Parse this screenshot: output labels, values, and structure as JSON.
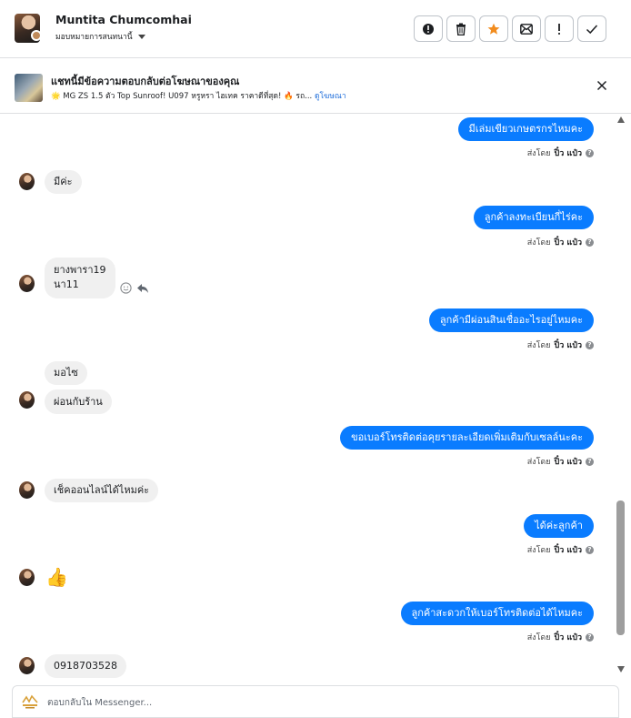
{
  "header": {
    "contact_name": "Muntita Chumcomhai",
    "assign_label": "มอบหมายการสนทนานี้",
    "actions": [
      {
        "icon": "exclamation-circle-icon",
        "glyph": "!"
      },
      {
        "icon": "trash-icon",
        "glyph": ""
      },
      {
        "icon": "star-icon",
        "glyph": "★"
      },
      {
        "icon": "mark-unread-icon",
        "glyph": ""
      },
      {
        "icon": "exclamation-icon",
        "glyph": "!"
      },
      {
        "icon": "check-icon",
        "glyph": "✓"
      }
    ]
  },
  "ad_banner": {
    "title": "แชทนี้มีข้อความตอบกลับต่อโฆษณาของคุณ",
    "subtitle": "🌟 MG ZS 1.5 ตัว Top Sunroof! U097 หรูหรา ไฮเทค ราคาดีที่สุด! 🔥 รถ...",
    "link": "ดูโฆษณา"
  },
  "messages": [
    {
      "dir": "out",
      "text": "มีเล่มเขียวเกษตรกรไหมคะ",
      "sent_by_prefix": "ส่งโดย",
      "sent_by_name": "ปิ๋ว แป๋ว"
    },
    {
      "dir": "in",
      "text": "มีค่ะ"
    },
    {
      "dir": "out",
      "text": "ลูกค้าลงทะเบียนกี่ไร่คะ",
      "sent_by_prefix": "ส่งโดย",
      "sent_by_name": "ปิ๋ว แป๋ว"
    },
    {
      "dir": "in",
      "text_lines": [
        "ยางพารา19",
        "นา11"
      ]
    },
    {
      "dir": "out",
      "text": "ลูกค้ามีผ่อนสินเชื่ออะไรอยู่ไหมคะ",
      "sent_by_prefix": "ส่งโดย",
      "sent_by_name": "ปิ๋ว แป๋ว"
    },
    {
      "dir": "in",
      "text": "มอไซ"
    },
    {
      "dir": "in",
      "text": "ผ่อนกับร้าน"
    },
    {
      "dir": "out",
      "text": "ขอเบอร์โทรติดต่อคุยรายละเอียดเพิ่มเติมกับเซลล์นะคะ",
      "sent_by_prefix": "ส่งโดย",
      "sent_by_name": "ปิ๋ว แป๋ว"
    },
    {
      "dir": "in",
      "text": "เช็คออนไลน์ได้ไหมค่ะ"
    },
    {
      "dir": "out",
      "text": "ได้ค่ะลูกค้า",
      "sent_by_prefix": "ส่งโดย",
      "sent_by_name": "ปิ๋ว แป๋ว"
    },
    {
      "dir": "in",
      "text": "👍"
    },
    {
      "dir": "out",
      "text": "ลูกค้าสะดวกให้เบอร์โทรติดต่อได้ไหมคะ",
      "sent_by_prefix": "ส่งโดย",
      "sent_by_name": "ปิ๋ว แป๋ว"
    },
    {
      "dir": "in",
      "text": "0918703528"
    }
  ],
  "composer": {
    "placeholder": "ตอบกลับใน Messenger..."
  }
}
